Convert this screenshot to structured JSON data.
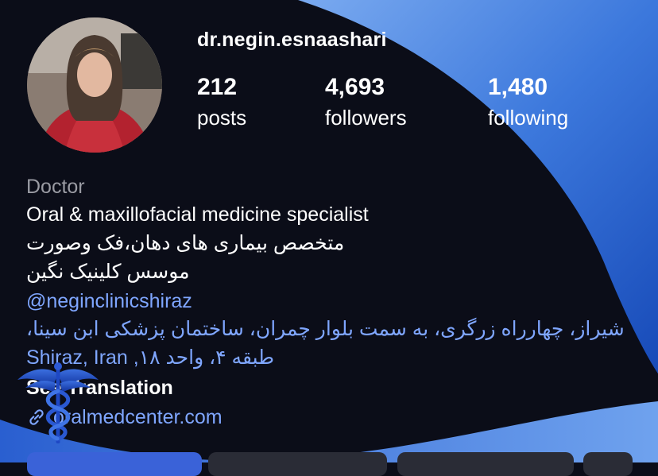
{
  "profile": {
    "username": "dr.negin.esnaashari",
    "stats": {
      "posts": {
        "value": "212",
        "label": "posts"
      },
      "followers": {
        "value": "4,693",
        "label": "followers"
      },
      "following": {
        "value": "1,480",
        "label": "following"
      }
    }
  },
  "bio": {
    "category": "Doctor",
    "line1": "Oral & maxillofacial medicine specialist",
    "line2": "متخصص بیماری های دهان،فک وصورت",
    "line3": "موسس کلینیک نگین",
    "mention": "@neginclinicshiraz",
    "address_line1": "شیراز، چهارراه زرگری، به سمت بلوار چمران، ساختمان پزشکی ابن سینا،",
    "address_line2": "طبقه ۴، واحد ۱۸, Shiraz, Iran",
    "translation": "See Translation",
    "link": "oralmedcenter.com"
  },
  "colors": {
    "background": "#0b0d18",
    "link": "#7fa6ff",
    "swoosh_light": "#6e9ee8",
    "swoosh_dark": "#1b4fc2"
  },
  "icons": [
    "link-icon",
    "caduceus-icon"
  ]
}
